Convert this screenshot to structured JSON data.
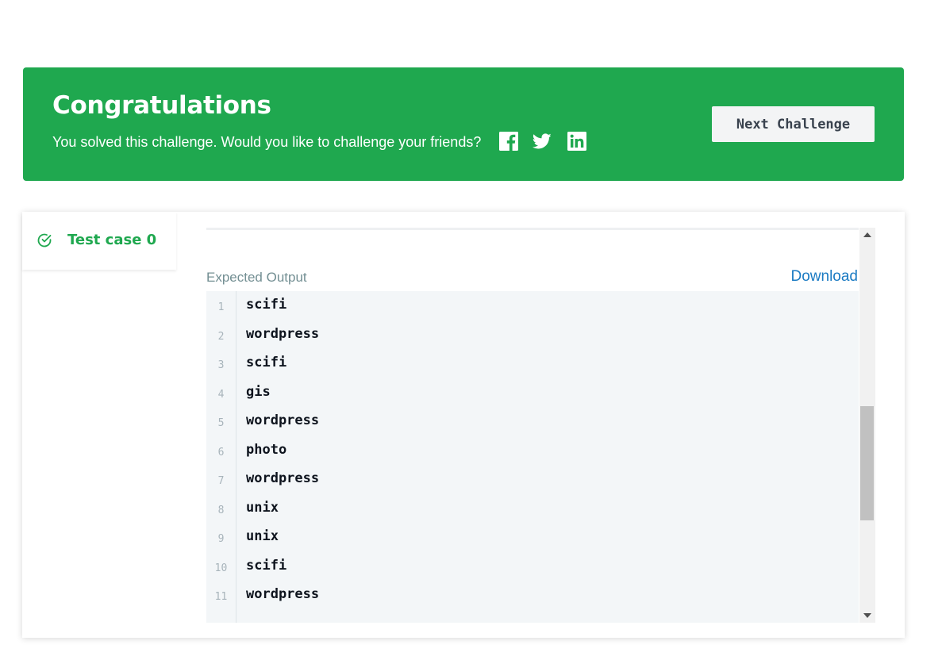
{
  "banner": {
    "title": "Congratulations",
    "subtitle": "You solved this challenge. Would you like to challenge your friends?",
    "social_icons": [
      "facebook-icon",
      "twitter-icon",
      "linkedin-icon"
    ],
    "next_button": "Next Challenge",
    "background_color": "#1fa84f"
  },
  "tabs": [
    {
      "label": "Test case 0",
      "status": "passed",
      "icon": "check-circle-icon"
    }
  ],
  "output": {
    "label": "Expected Output",
    "download": "Download",
    "lines": [
      {
        "num": "1",
        "text": "scifi"
      },
      {
        "num": "2",
        "text": "wordpress"
      },
      {
        "num": "3",
        "text": "scifi"
      },
      {
        "num": "4",
        "text": "gis"
      },
      {
        "num": "5",
        "text": "wordpress"
      },
      {
        "num": "6",
        "text": "photo"
      },
      {
        "num": "7",
        "text": "wordpress"
      },
      {
        "num": "8",
        "text": "unix"
      },
      {
        "num": "9",
        "text": "unix"
      },
      {
        "num": "10",
        "text": "scifi"
      },
      {
        "num": "11",
        "text": "wordpress"
      }
    ]
  }
}
